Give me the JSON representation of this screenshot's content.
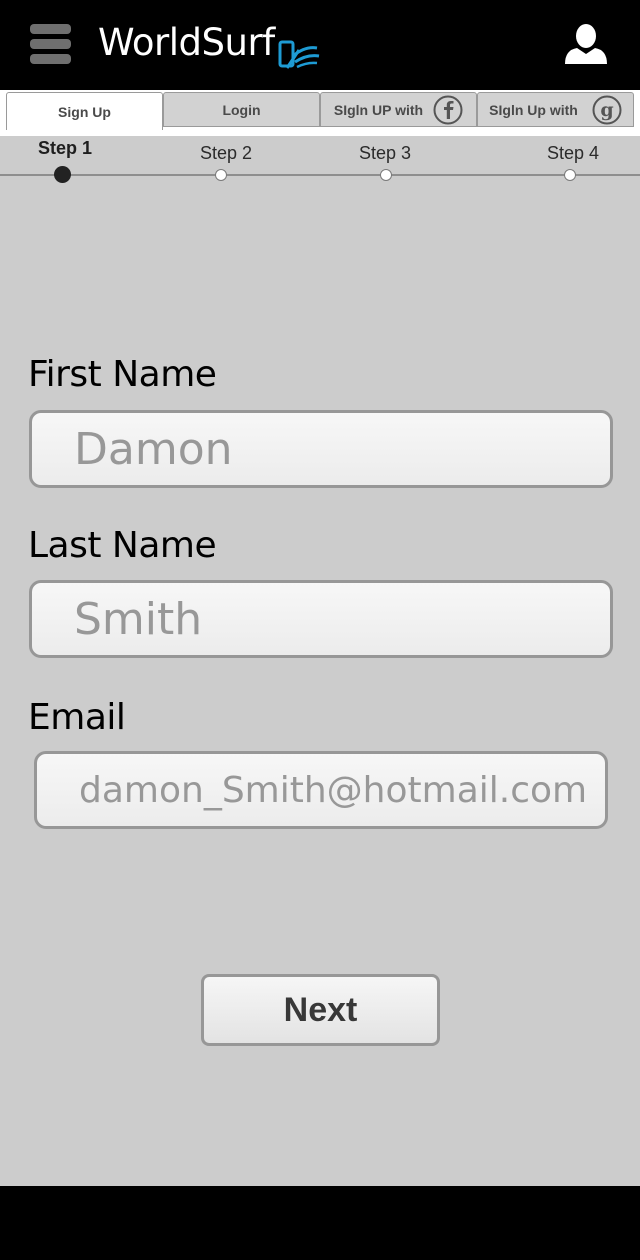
{
  "app": {
    "title": "WorldSurf",
    "menu_icon": "hamburger-menu-icon",
    "logo_icon": "phone-wave-logo-icon",
    "user_icon": "user-profile-icon"
  },
  "tabs": [
    {
      "label": "Sign Up",
      "active": true
    },
    {
      "label": "Login",
      "active": false
    },
    {
      "label": "SIgln UP with",
      "icon": "facebook-icon",
      "active": false
    },
    {
      "label": "SIgln Up with",
      "icon": "google-icon",
      "active": false
    }
  ],
  "steps": [
    {
      "label": "Step 1",
      "current": true
    },
    {
      "label": "Step 2",
      "current": false
    },
    {
      "label": "Step 3",
      "current": false
    },
    {
      "label": "Step 4",
      "current": false
    }
  ],
  "form": {
    "first_name": {
      "label": "First Name",
      "placeholder": "Damon"
    },
    "last_name": {
      "label": "Last Name",
      "placeholder": "Smith"
    },
    "email": {
      "label": "Email",
      "placeholder": "damon_Smith@hotmail.com"
    },
    "next_label": "Next"
  },
  "colors": {
    "header_bg": "#000000",
    "panel_bg": "#cccccc",
    "logo_accent": "#1e9bd4"
  }
}
